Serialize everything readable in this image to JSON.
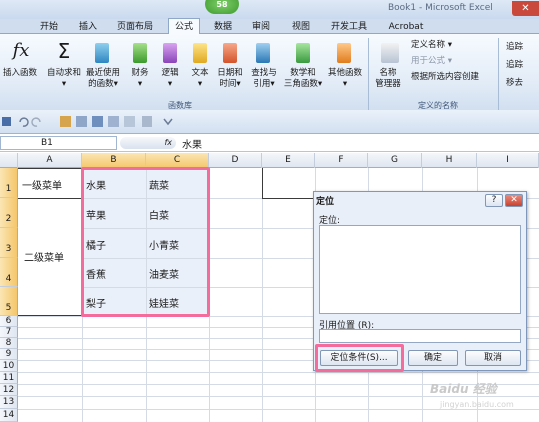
{
  "window": {
    "title": "Book1 - Microsoft Excel",
    "close_glyph": "✕",
    "formula_badge": "58"
  },
  "tabs": [
    "开始",
    "插入",
    "页面布局",
    "公式",
    "数据",
    "审阅",
    "视图",
    "开发工具",
    "Acrobat"
  ],
  "ribbon": {
    "insert_function": {
      "glyph": "fx",
      "label": "插入函数"
    },
    "autosum": {
      "glyph": "Σ",
      "line1": "自动求和",
      "line2": "▾"
    },
    "recent": {
      "line1": "最近使用",
      "line2": "的函数▾"
    },
    "financial": {
      "line1": "财务",
      "line2": "▾"
    },
    "logical": {
      "line1": "逻辑",
      "line2": "▾"
    },
    "text": {
      "line1": "文本",
      "line2": "▾"
    },
    "datetime": {
      "line1": "日期和",
      "line2": "时间▾"
    },
    "lookup": {
      "line1": "查找与",
      "line2": "引用▾"
    },
    "math": {
      "line1": "数学和",
      "line2": "三角函数▾"
    },
    "other": {
      "line1": "其他函数",
      "line2": "▾"
    },
    "function_library": "函数库",
    "name_manager": {
      "line1": "名称",
      "line2": "管理器"
    },
    "define_name": "定义名称 ▾",
    "use_in_formula": "用于公式 ▾",
    "create_from_selection": "根据所选内容创建",
    "defined_names": "定义的名称",
    "trace_prec": "追踪",
    "trace_dep": "追踪",
    "remove_arrows": "移去"
  },
  "formula_bar": {
    "name_box": "B1",
    "fx_label": "fx",
    "value": "水果"
  },
  "columns": [
    "A",
    "B",
    "C",
    "D",
    "E",
    "F",
    "G",
    "H",
    "I"
  ],
  "rows": [
    "1",
    "2",
    "3",
    "4",
    "5",
    "6",
    "7",
    "8",
    "9",
    "10",
    "11",
    "12",
    "13",
    "14"
  ],
  "cells": {
    "A1": "一级菜单",
    "A2": "二级菜单",
    "B": [
      "水果",
      "苹果",
      "橘子",
      "香蕉",
      "梨子"
    ],
    "C": [
      "蔬菜",
      "白菜",
      "小青菜",
      "油麦菜",
      "娃娃菜"
    ]
  },
  "dialog": {
    "title": "定位",
    "help": "?",
    "close": "✕",
    "goto_label": "定位:",
    "ref_label": "引用位置 (R):",
    "special_button": "定位条件(S)...",
    "ok_button": "确定",
    "cancel_button": "取消"
  },
  "watermark": {
    "main": "Baidu 经验",
    "sub": "jingyan.baidu.com"
  },
  "colors": {
    "highlight": "#f36c9c",
    "selection": "#eaf0f9",
    "header_selected": "#f4c66b"
  }
}
